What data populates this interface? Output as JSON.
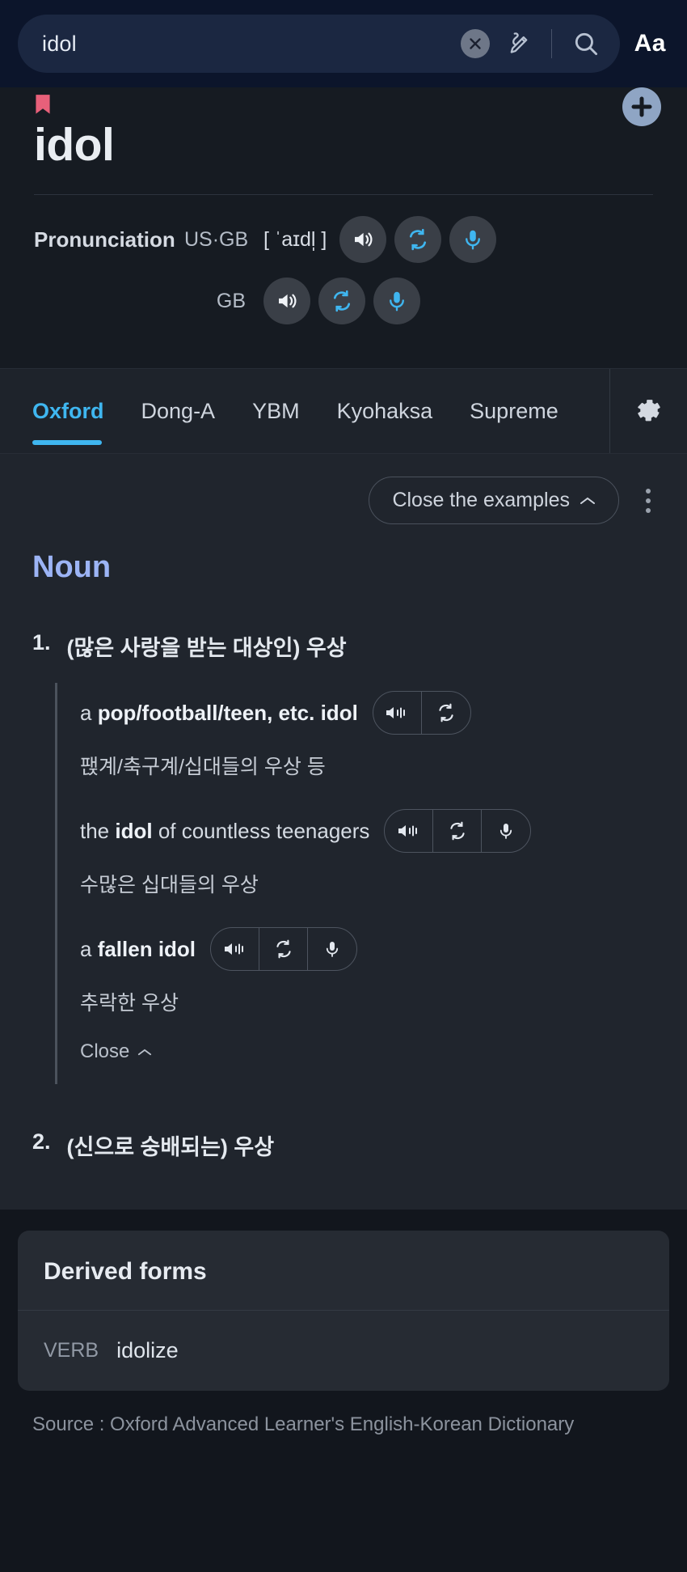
{
  "search": {
    "value": "idol",
    "clear_icon": "close-circle-icon",
    "handwrite_icon": "pen-icon",
    "search_icon": "magnifier-icon",
    "font_size_label": "Aa"
  },
  "word_header": {
    "bookmark_icon": "bookmark-icon",
    "add_icon": "plus-circle-icon",
    "headword": "idol"
  },
  "pronunciation": {
    "label": "Pronunciation",
    "rows": [
      {
        "region": "US·GB",
        "ipa": "[ ˈaɪdl̩ ]",
        "buttons": [
          "speaker-icon",
          "repeat-icon",
          "microphone-icon"
        ]
      },
      {
        "region": "GB",
        "ipa": "",
        "buttons": [
          "speaker-icon",
          "repeat-icon",
          "microphone-icon"
        ]
      }
    ]
  },
  "tabs": {
    "items": [
      {
        "label": "Oxford",
        "active": true
      },
      {
        "label": "Dong-A",
        "active": false
      },
      {
        "label": "YBM",
        "active": false
      },
      {
        "label": "Kyohaksa",
        "active": false
      },
      {
        "label": "Supreme",
        "active": false
      }
    ],
    "settings_icon": "gear-icon",
    "active_color": "#3fb6f0"
  },
  "content": {
    "examples_toggle": "Close the examples",
    "examples_toggle_chevron": "chevron-up-icon",
    "more_menu_icon": "kebab-menu-icon",
    "part_of_speech": "Noun",
    "senses": [
      {
        "num": "1.",
        "definition": "(많은 사랑을 받는 대상인) 우상",
        "examples": [
          {
            "prefix": "a ",
            "bold": "pop/football/teen, etc. idol",
            "suffix": "",
            "korean": "팭계/축구계/십대들의 우상 등",
            "buttons": [
              "speaker-icon",
              "repeat-icon"
            ]
          },
          {
            "prefix": "the ",
            "bold": "idol",
            "suffix": " of countless teenagers",
            "korean": "수많은 십대들의 우상",
            "buttons": [
              "speaker-icon",
              "repeat-icon",
              "microphone-icon"
            ]
          },
          {
            "prefix": "a ",
            "bold": "fallen idol",
            "suffix": "",
            "korean": "추락한 우상",
            "buttons": [
              "speaker-icon",
              "repeat-icon",
              "microphone-icon"
            ]
          }
        ],
        "close_label": "Close"
      },
      {
        "num": "2.",
        "definition": "(신으로 숭배되는) 우상",
        "examples": [],
        "close_label": ""
      }
    ]
  },
  "derived_forms": {
    "title": "Derived forms",
    "rows": [
      {
        "pos": "VERB",
        "word": "idolize"
      }
    ]
  },
  "source": "Source : Oxford Advanced Learner's English-Korean Dictionary"
}
